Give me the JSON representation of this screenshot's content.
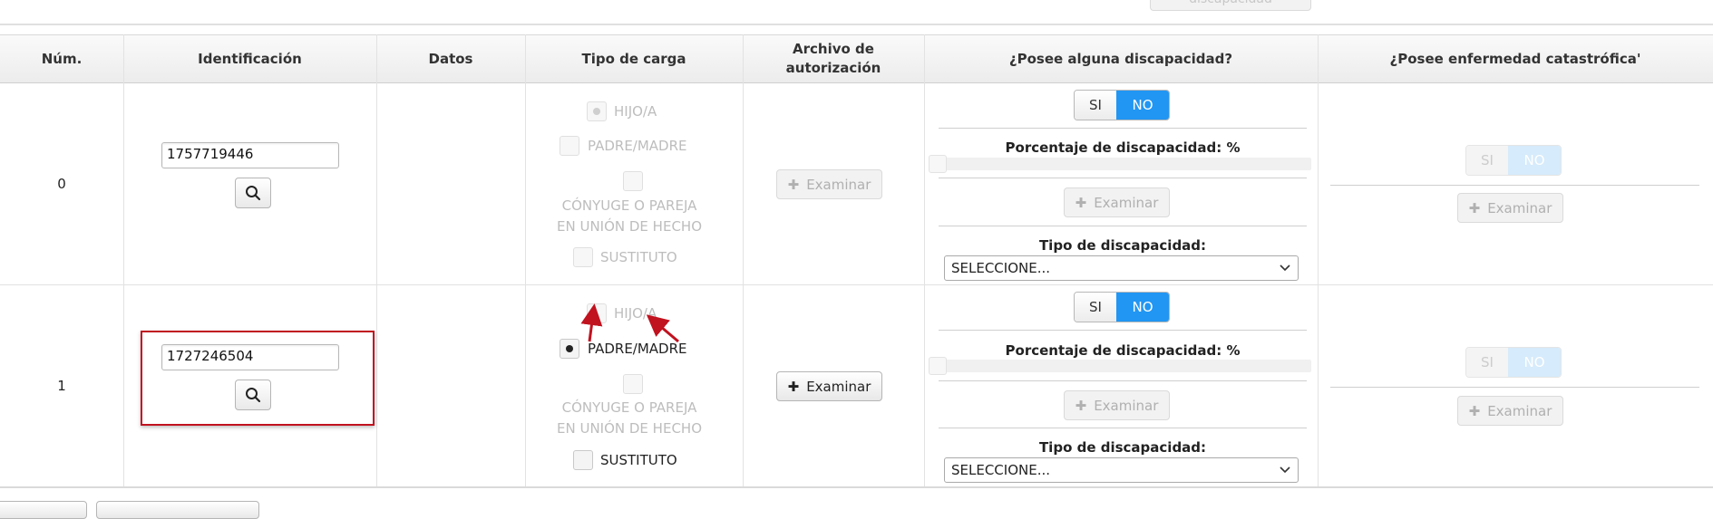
{
  "top_partial_button_label": "discapacidad",
  "columns": {
    "num": "Núm.",
    "identificacion": "Identificación",
    "datos": "Datos",
    "tipo_carga": "Tipo de carga",
    "archivo_line1": "Archivo de",
    "archivo_line2": "autorización",
    "discapacidad": "¿Posee alguna discapacidad?",
    "enfermedad": "¿Posee enfermedad catastrófica'"
  },
  "rows": [
    {
      "num": "0",
      "identificacion": "1757719446",
      "tipo_carga_selected": "HIJO/A",
      "tipo_carga_enabled": false,
      "archivo_enabled": false,
      "discapacidad": "NO",
      "enfermedad": "NO"
    },
    {
      "num": "1",
      "identificacion": "1727246504",
      "tipo_carga_selected": "PADRE/MADRE",
      "tipo_carga_enabled": true,
      "archivo_enabled": true,
      "discapacidad": "NO",
      "enfermedad": "NO"
    }
  ],
  "tipo_carga_options": {
    "hijo": "HIJO/A",
    "padre": "PADRE/MADRE",
    "conyuge_line1": "CÓNYUGE O PAREJA",
    "conyuge_line2": "EN UNIÓN DE HECHO",
    "sustituto": "SUSTITUTO"
  },
  "labels": {
    "examinar": "Examinar",
    "si": "SI",
    "no": "NO",
    "porcentaje": "Porcentaje de discapacidad: %",
    "tipo_discapacidad": "Tipo de discapacidad:",
    "select_placeholder": "SELECCIONE..."
  },
  "colors": {
    "accent": "#2196f3",
    "highlight_box": "#c1121f"
  }
}
